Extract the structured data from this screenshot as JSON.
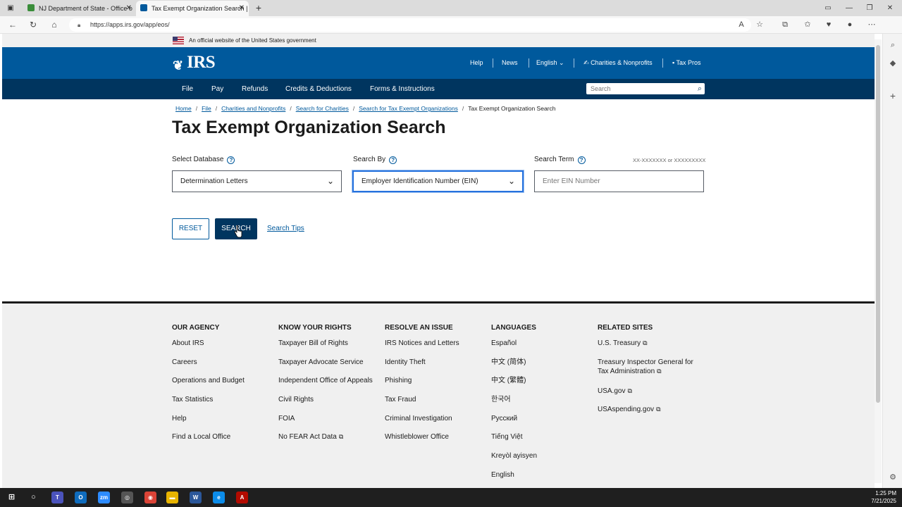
{
  "browser": {
    "tabs": [
      {
        "title": "NJ Department of State - Office o",
        "active": false
      },
      {
        "title": "Tax Exempt Organization Search |",
        "active": true
      }
    ],
    "url": "https://apps.irs.gov/app/eos/"
  },
  "gov_banner": "An official website of the United States government",
  "header": {
    "logo": "IRS",
    "links": {
      "help": "Help",
      "news": "News",
      "language": "English",
      "charities": "Charities & Nonprofits",
      "tax_pros": "Tax Pros"
    }
  },
  "nav": {
    "items": [
      "File",
      "Pay",
      "Refunds",
      "Credits & Deductions",
      "Forms & Instructions"
    ],
    "search_placeholder": "Search"
  },
  "breadcrumb": [
    "Home",
    "File",
    "Charities and Nonprofits",
    "Search for Charities",
    "Search for Tax Exempt Organizations",
    "Tax Exempt Organization Search"
  ],
  "page_title": "Tax Exempt Organization Search",
  "form": {
    "database_label": "Select Database",
    "database_value": "Determination Letters",
    "search_by_label": "Search By",
    "search_by_value": "Employer Identification Number (EIN)",
    "term_label": "Search Term",
    "term_hint": "XX-XXXXXXX or XXXXXXXXX",
    "term_placeholder": "Enter EIN Number",
    "reset_label": "RESET",
    "search_label": "SEARCH",
    "tips_label": "Search Tips"
  },
  "footer": {
    "columns": [
      {
        "heading": "OUR AGENCY",
        "items": [
          "About IRS",
          "Careers",
          "Operations and Budget",
          "Tax Statistics",
          "Help",
          "Find a Local Office"
        ]
      },
      {
        "heading": "KNOW YOUR RIGHTS",
        "items": [
          "Taxpayer Bill of Rights",
          "Taxpayer Advocate Service",
          "Independent Office of Appeals",
          "Civil Rights",
          "FOIA",
          "No FEAR Act Data"
        ]
      },
      {
        "heading": "RESOLVE AN ISSUE",
        "items": [
          "IRS Notices and Letters",
          "Identity Theft",
          "Phishing",
          "Tax Fraud",
          "Criminal Investigation",
          "Whistleblower Office"
        ]
      },
      {
        "heading": "LANGUAGES",
        "items": [
          "Español",
          "中文 (简体)",
          "中文 (繁體)",
          "한국어",
          "Русский",
          "Tiếng Việt",
          "Kreyòl ayisyen",
          "English"
        ]
      },
      {
        "heading": "RELATED SITES",
        "items": [
          "U.S. Treasury",
          "Treasury Inspector General for Tax Administration",
          "USA.gov",
          "USAspending.gov"
        ]
      }
    ]
  },
  "taskbar": {
    "time": "1:25 PM",
    "date": "7/21/2025"
  }
}
